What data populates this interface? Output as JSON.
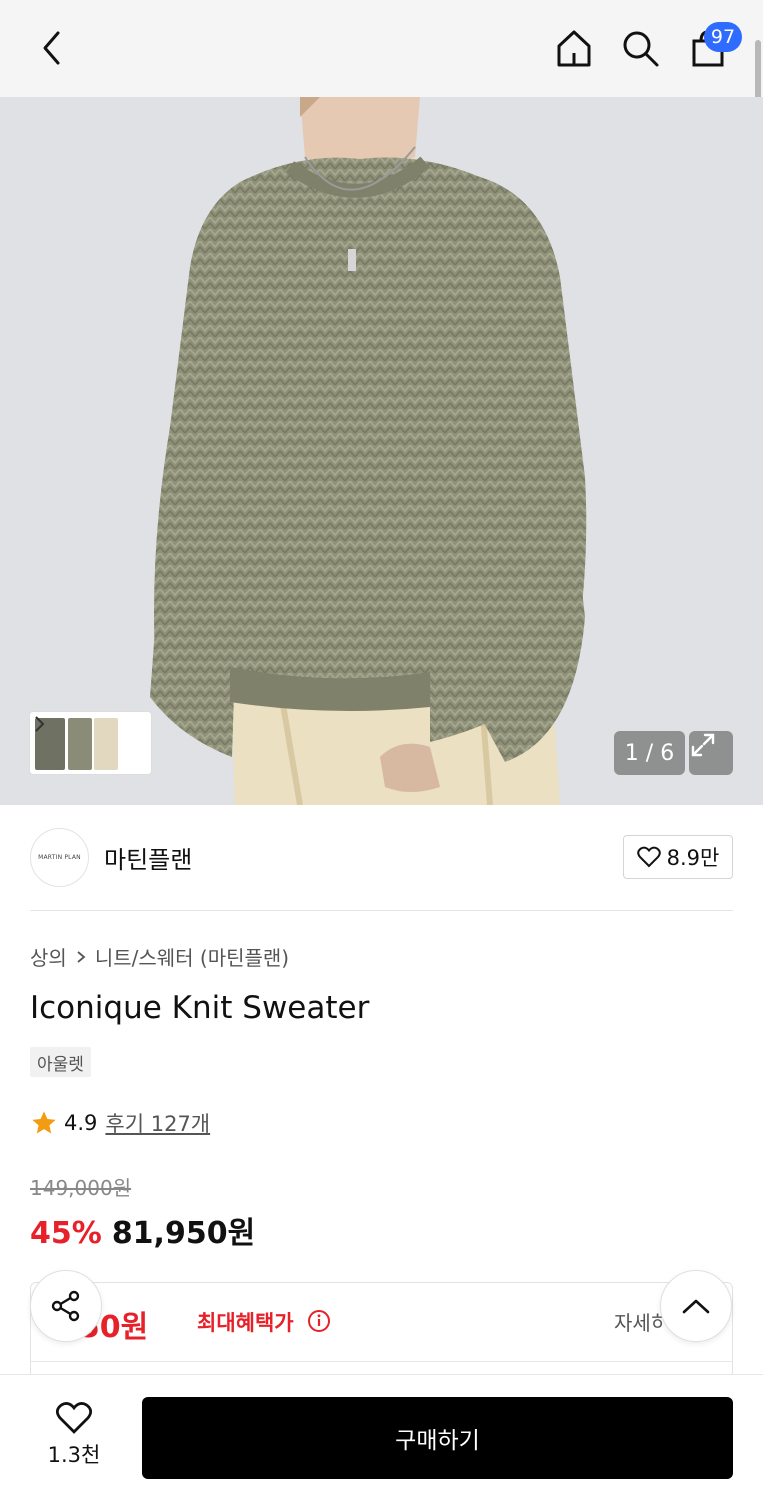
{
  "header": {
    "cart_count": "97",
    "icons": [
      "chevron-left-icon",
      "home-icon",
      "search-icon",
      "shopping-bag-icon"
    ]
  },
  "gallery": {
    "counter": "1 / 6"
  },
  "brand": {
    "logo_text": "MARTIN PLAN",
    "name": "마틴플랜",
    "like_count": "8.9만"
  },
  "product": {
    "breadcrumb": [
      "상의",
      "니트/스웨터 (마틴플랜)"
    ],
    "title": "Iconique Knit Sweater",
    "tag": "아울렛",
    "rating": "4.9",
    "review_link": "후기 127개",
    "original_price": "149,000원",
    "discount": "45%",
    "sale_price": "81,950원"
  },
  "benefit": {
    "price": "950원",
    "label": "최대혜택가",
    "detail": "자세히"
  },
  "bottom": {
    "wish_count": "1.3천",
    "buy_label": "구매하기"
  },
  "colors": {
    "accent_red": "#e6212a",
    "badge_blue": "#2f6bff",
    "sweater": "#8e9078"
  }
}
